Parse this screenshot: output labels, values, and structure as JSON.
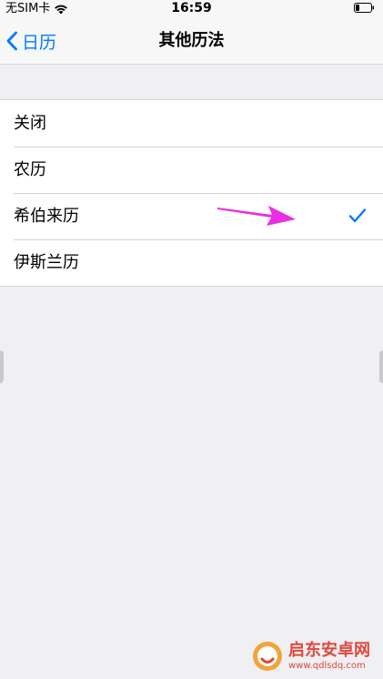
{
  "status_bar": {
    "carrier": "无SIM卡",
    "time": "16:59"
  },
  "nav": {
    "back_label": "日历",
    "title": "其他历法"
  },
  "calendars": [
    {
      "label": "关闭",
      "selected": false
    },
    {
      "label": "农历",
      "selected": false
    },
    {
      "label": "希伯来历",
      "selected": true
    },
    {
      "label": "伊斯兰历",
      "selected": false
    }
  ],
  "colors": {
    "accent": "#007aff",
    "annotation_arrow": "#e930e0",
    "background": "#efeff4"
  },
  "watermark": {
    "title": "启东安卓网",
    "url": "www.qdlsdq.com"
  }
}
